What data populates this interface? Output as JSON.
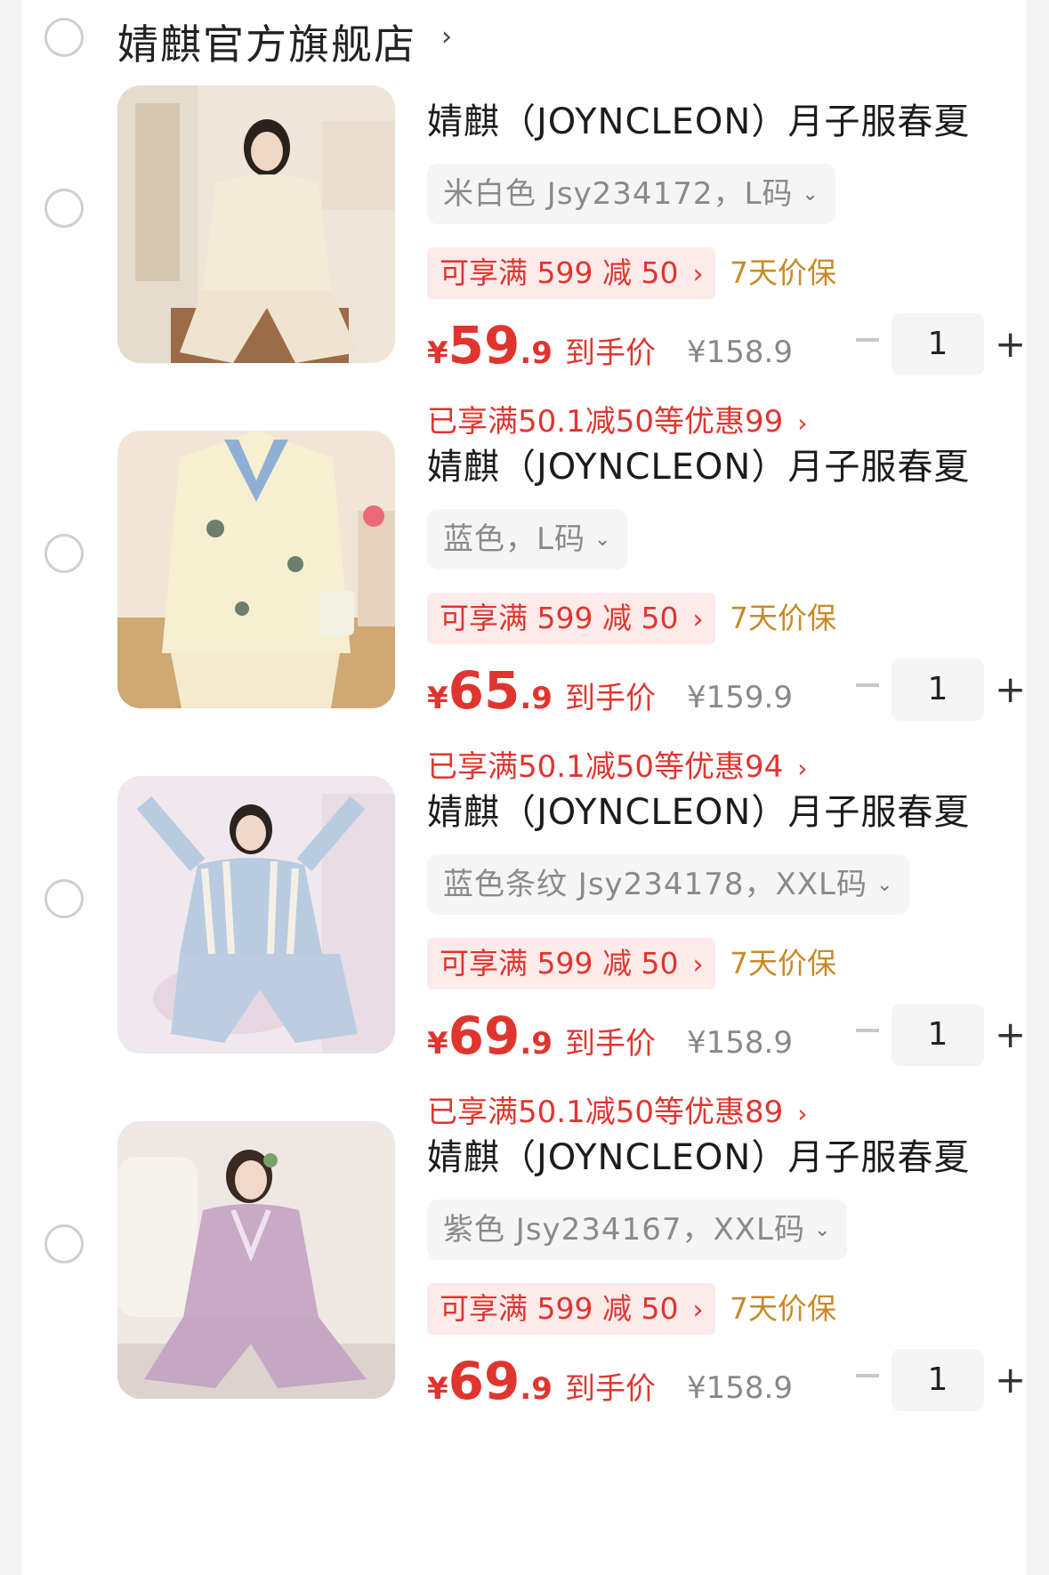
{
  "store": {
    "name": "婧麒官方旗舰店",
    "arrow": "›"
  },
  "items": [
    {
      "title": "婧麒（JOYNCLEON）月子服春夏",
      "spec": "米白色 Jsy234172，L码",
      "promo": "可享满 599 减 50",
      "promo_arrow": "›",
      "guarantee": "7天价保",
      "price_yen": "¥",
      "price_int": "59",
      "price_dec": ".9",
      "final_label": "到手价",
      "orig_price": "¥158.9",
      "quantity": "1",
      "saved": "已享满50.1减50等优惠99",
      "saved_arrow": "›",
      "thumb_colors": {
        "bg": "#d9c7b4",
        "outfit": "#f3ead8",
        "wall": "#efe5d8"
      }
    },
    {
      "title": "婧麒（JOYNCLEON）月子服春夏",
      "spec": "蓝色，L码",
      "promo": "可享满 599 减 50",
      "promo_arrow": "›",
      "guarantee": "7天价保",
      "price_yen": "¥",
      "price_int": "65",
      "price_dec": ".9",
      "final_label": "到手价",
      "orig_price": "¥159.9",
      "quantity": "1",
      "saved": "已享满50.1减50等优惠94",
      "saved_arrow": "›",
      "thumb_colors": {
        "bg": "#cfa874",
        "outfit": "#f7efd2",
        "wall": "#f1e6d6"
      }
    },
    {
      "title": "婧麒（JOYNCLEON）月子服春夏",
      "spec": "蓝色条纹 Jsy234178，XXL码",
      "promo": "可享满 599 减 50",
      "promo_arrow": "›",
      "guarantee": "7天价保",
      "price_yen": "¥",
      "price_int": "69",
      "price_dec": ".9",
      "final_label": "到手价",
      "orig_price": "¥158.9",
      "quantity": "1",
      "saved": "已享满50.1减50等优惠89",
      "saved_arrow": "›",
      "thumb_colors": {
        "bg": "#e6d6e2",
        "outfit": "#b9cbe0",
        "wall": "#f1e8ee"
      }
    },
    {
      "title": "婧麒（JOYNCLEON）月子服春夏",
      "spec": "紫色 Jsy234167，XXL码",
      "promo": "可享满 599 减 50",
      "promo_arrow": "›",
      "guarantee": "7天价保",
      "price_yen": "¥",
      "price_int": "69",
      "price_dec": ".9",
      "final_label": "到手价",
      "orig_price": "¥158.9",
      "quantity": "1",
      "thumb_colors": {
        "bg": "#ddd2cd",
        "outfit": "#c8a9c6",
        "wall": "#eee7e3"
      }
    }
  ],
  "colors": {
    "accent_red": "#e0352f",
    "promo_bg": "#fdeaea",
    "guarantee_gold": "#c88a28"
  }
}
